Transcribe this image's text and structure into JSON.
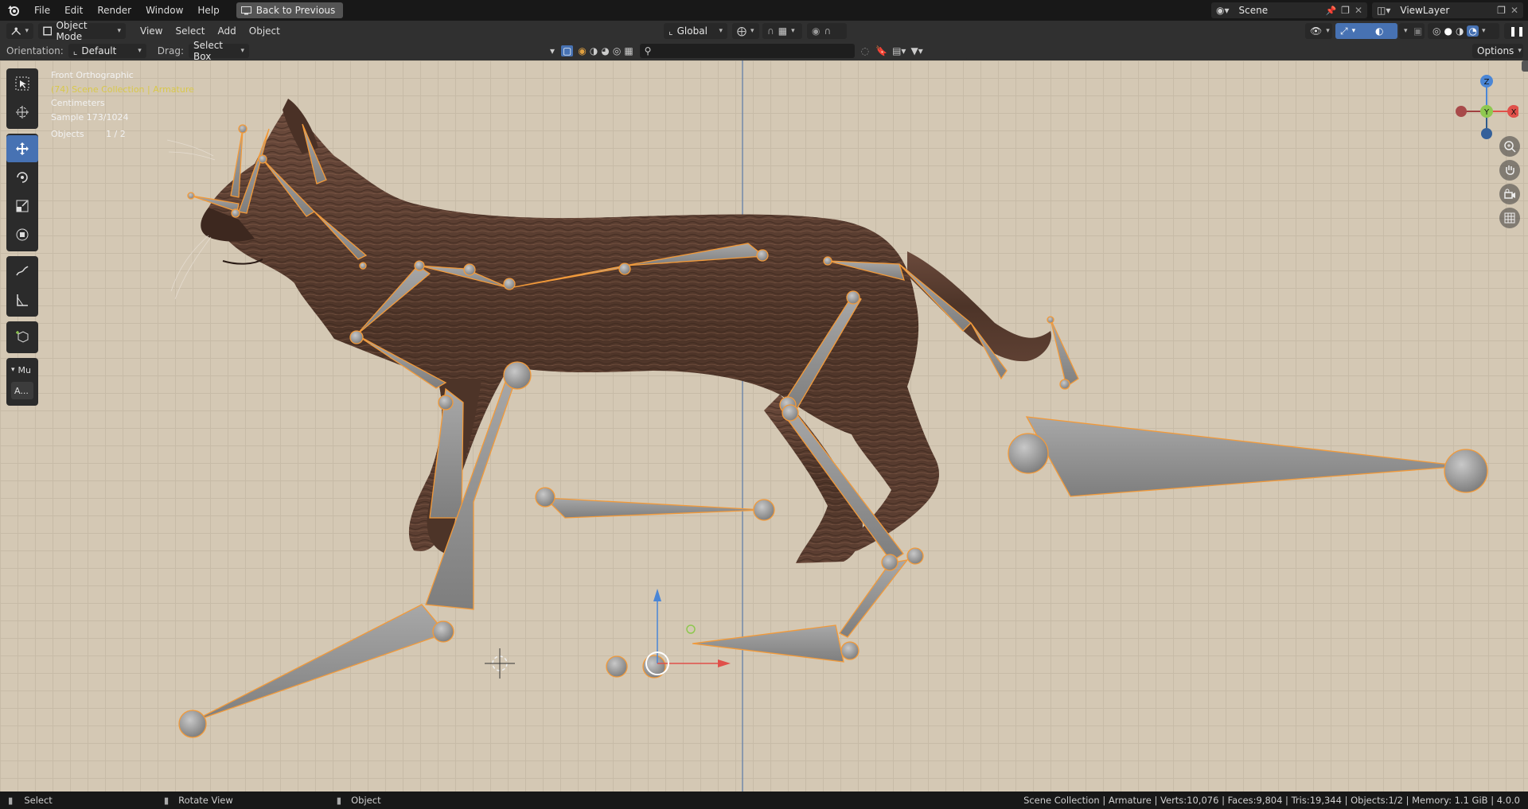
{
  "menu": {
    "items": [
      "File",
      "Edit",
      "Render",
      "Window",
      "Help"
    ],
    "back_button": "Back to Previous"
  },
  "scene": {
    "label": "Scene",
    "view_layer": "ViewLayer"
  },
  "header": {
    "mode": "Object Mode",
    "menus": [
      "View",
      "Select",
      "Add",
      "Object"
    ],
    "transform_orientation": "Global",
    "options_label": "Options"
  },
  "tool_settings": {
    "orientation_label": "Orientation:",
    "orientation_value": "Default",
    "drag_label": "Drag:",
    "drag_value": "Select Box"
  },
  "viewport_overlay": {
    "view_name": "Front Orthographic",
    "collection": "(74) Scene Collection | Armature",
    "units": "Centimeters",
    "sample": "Sample 173/1024",
    "objects_label": "Objects",
    "objects_value": "1 / 2"
  },
  "sidebar_tabs": {
    "tab1": "Mu",
    "tab2": "A..."
  },
  "gizmo": {
    "z": "Z",
    "y": "Y",
    "x": "X"
  },
  "status": {
    "left": "Select",
    "middle": "Rotate View",
    "right": "Object",
    "info": "Scene Collection | Armature | Verts:10,076 | Faces:9,804 | Tris:19,344 | Objects:1/2 | Memory: 1.1 GiB | 4.0.0"
  },
  "colors": {
    "accent": "#4772b3",
    "selection_outline": "#f29a3a",
    "viewport_bg": "#d4c8b4",
    "fur": "#5a3e32"
  },
  "icons": [
    "blender-logo-icon",
    "select-box-icon",
    "cursor-icon",
    "move-icon",
    "rotate-icon",
    "scale-icon",
    "transform-icon",
    "annotate-icon",
    "measure-icon",
    "add-cube-icon",
    "zoom-icon",
    "hand-icon",
    "camera-icon",
    "grid-icon"
  ]
}
